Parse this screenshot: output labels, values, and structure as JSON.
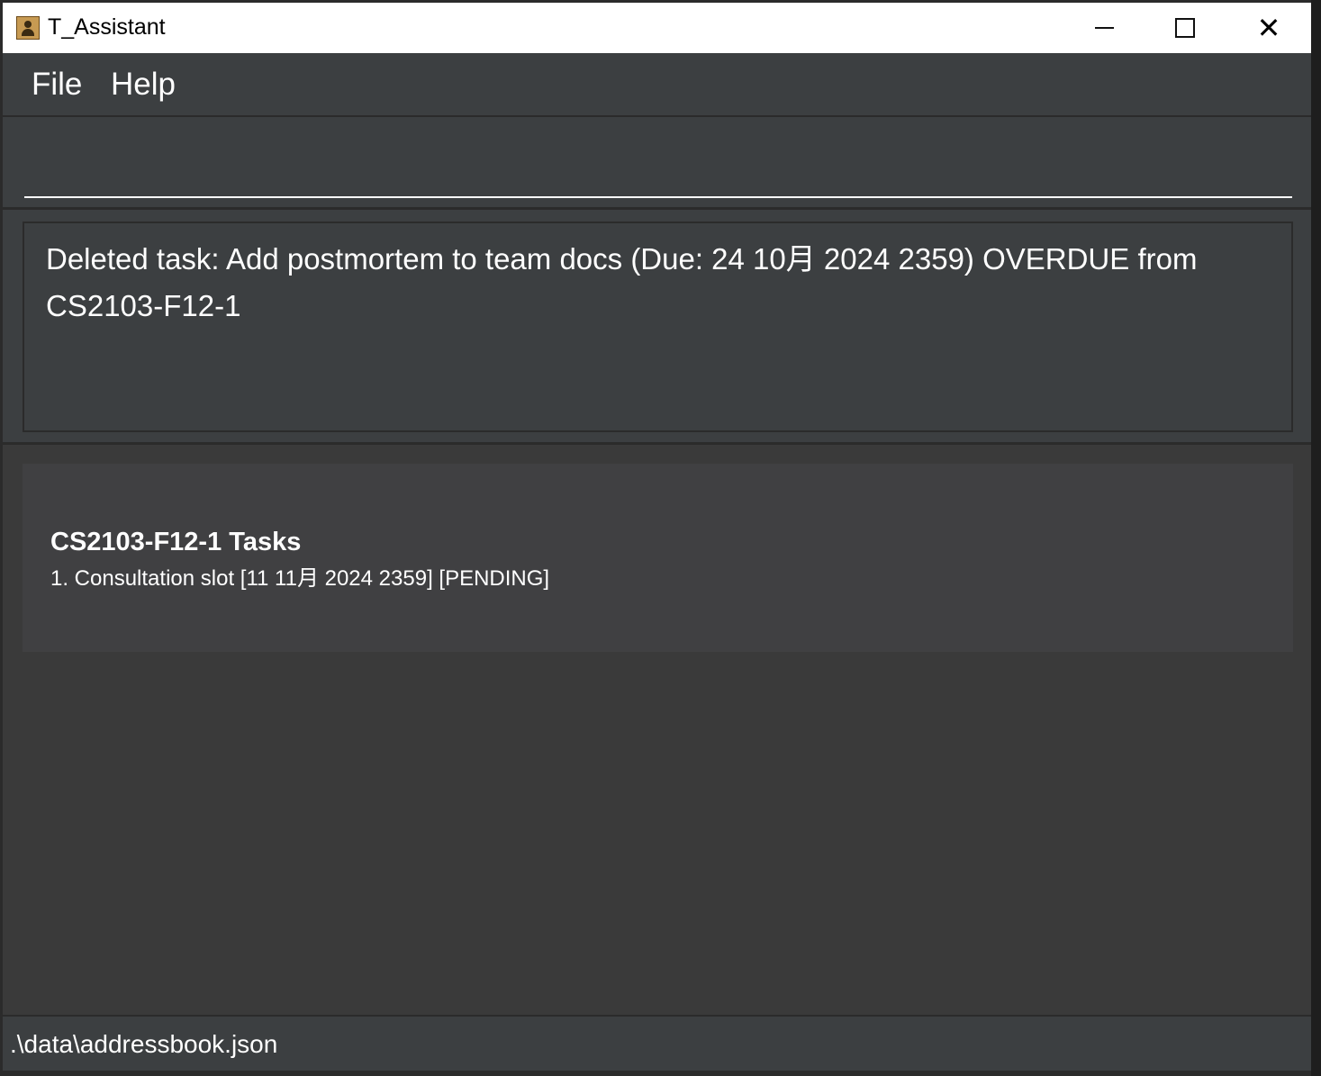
{
  "window": {
    "title": "T_Assistant",
    "icon": "address-book-icon",
    "controls": {
      "minimize": "minimize-icon",
      "maximize": "maximize-icon",
      "close": "close-icon",
      "close_glyph": "✕"
    }
  },
  "menubar": {
    "items": [
      {
        "label": "File"
      },
      {
        "label": "Help"
      }
    ]
  },
  "command_box": {
    "value": "",
    "placeholder": ""
  },
  "result_display": {
    "text": "Deleted task: Add postmortem to team docs (Due: 24 10月 2024 2359) OVERDUE from CS2103-F12-1"
  },
  "task_list": {
    "title": "CS2103-F12-1 Tasks",
    "items": [
      "1. Consultation slot [11 11月 2024 2359] [PENDING]"
    ]
  },
  "status_bar": {
    "path": ".\\data\\addressbook.json"
  },
  "colors": {
    "panel_bg": "#3c3f41",
    "border": "#2b2b2b",
    "card_bg": "#404042",
    "text": "#ffffff"
  }
}
